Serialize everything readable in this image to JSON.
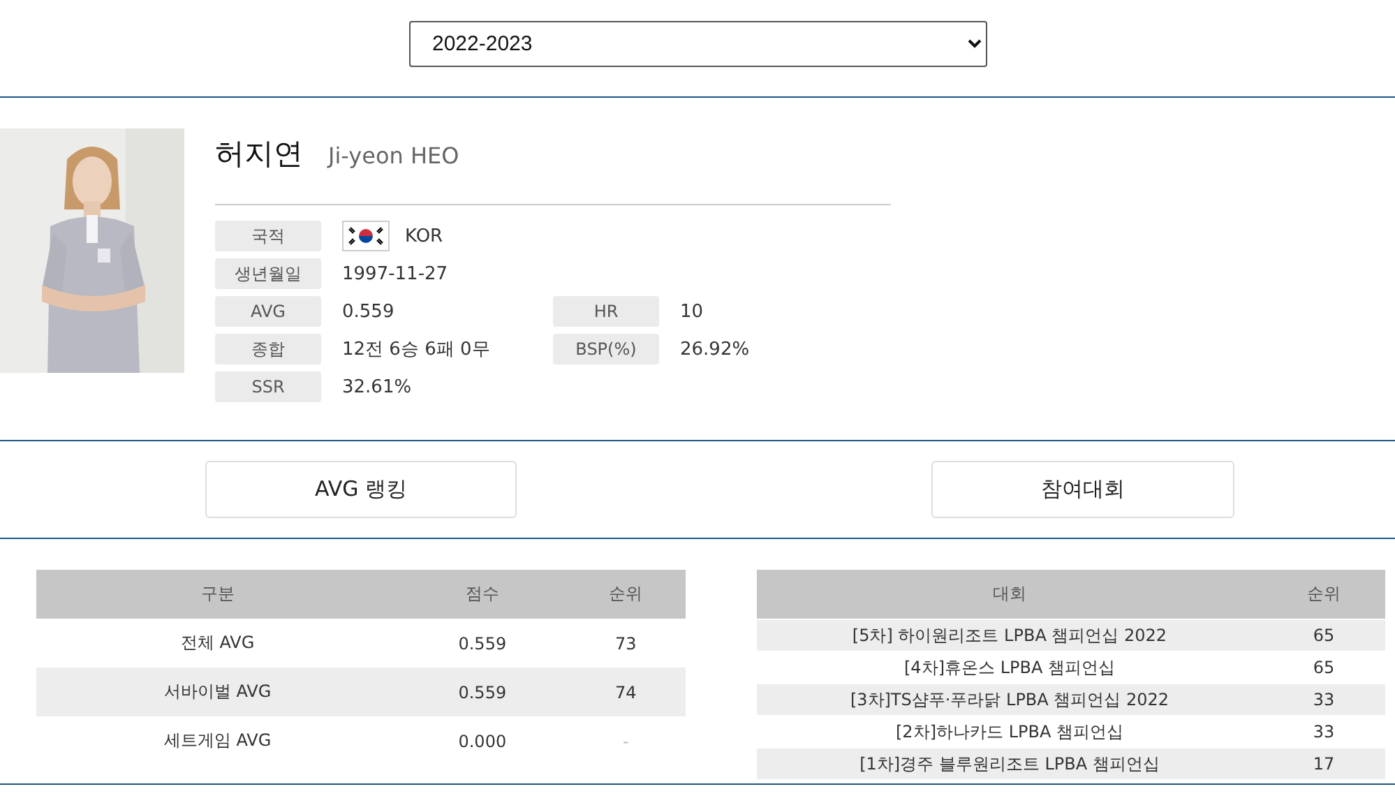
{
  "season_select": {
    "value": "2022-2023"
  },
  "player": {
    "photo": {
      "kind": "picture"
    },
    "name_ko": "허지연",
    "name_en": "Ji-yeon HEO",
    "info": [
      [
        {
          "label": "국적",
          "value": "KOR",
          "kind": "flag"
        }
      ],
      [
        {
          "label": "생년월일",
          "value": "1997-11-27",
          "kind": "text"
        }
      ],
      [
        {
          "label": "AVG",
          "value": "0.559",
          "kind": "text"
        },
        {
          "label": "HR",
          "value": "10",
          "kind": "text"
        }
      ],
      [
        {
          "label": "종합",
          "value": "12전 6승 6패 0무",
          "kind": "text"
        },
        {
          "label": "BSP(%)",
          "value": "26.92%",
          "kind": "text"
        }
      ],
      [
        {
          "label": "SSR",
          "value": "32.61%",
          "kind": "text"
        }
      ]
    ]
  },
  "buttons": [
    "AVG 랭킹",
    "참여대회"
  ],
  "avg_table": {
    "columns": [
      "구분",
      "점수",
      "순위"
    ],
    "rows": [
      [
        "전체 AVG",
        "0.559",
        "73"
      ],
      [
        "서바이벌 AVG",
        "0.559",
        "74"
      ],
      [
        "세트게임 AVG",
        "0.000",
        "-"
      ]
    ]
  },
  "tournament_table": {
    "columns": [
      "대회",
      "순위"
    ],
    "rows": [
      [
        "[5차] 하이원리조트 LPBA 챔피언십 2022",
        "65"
      ],
      [
        "[4차]휴온스 LPBA 챔피언십",
        "65"
      ],
      [
        "[3차]TS샴푸·푸라닭 LPBA 챔피언십 2022",
        "33"
      ],
      [
        "[2차]하나카드 LPBA 챔피언십",
        "33"
      ],
      [
        "[1차]경주 블루원리조트 LPBA 챔피언십",
        "17"
      ]
    ]
  }
}
